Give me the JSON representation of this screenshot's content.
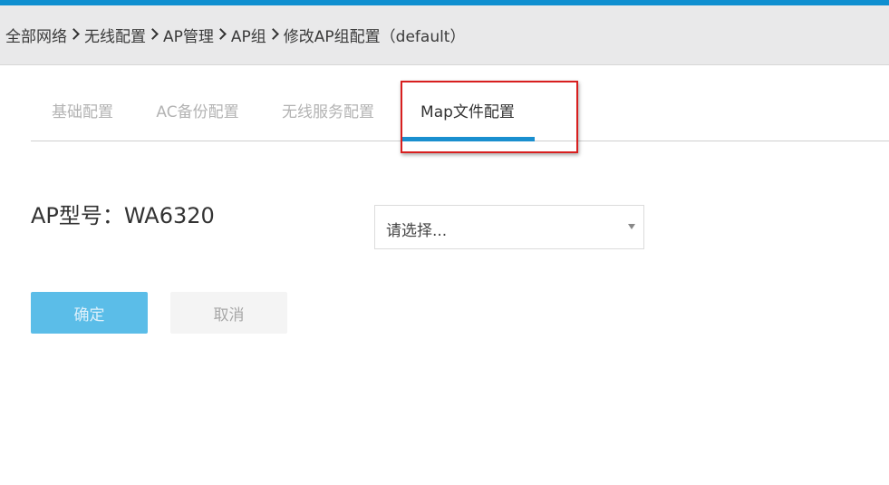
{
  "colors": {
    "top_strip": "#0f8fd0",
    "active_tab_indicator": "#1a8fcf",
    "highlight_box": "#d81f1f",
    "primary_button": "#5bbde8"
  },
  "breadcrumb": {
    "items": [
      "全部网络",
      "无线配置",
      "AP管理",
      "AP组",
      "修改AP组配置（default）"
    ]
  },
  "tabs": [
    {
      "label": "基础配置",
      "active": false
    },
    {
      "label": "AC备份配置",
      "active": false
    },
    {
      "label": "无线服务配置",
      "active": false
    },
    {
      "label": "Map文件配置",
      "active": true
    }
  ],
  "form": {
    "model_label": "AP型号：WA6320",
    "select_placeholder": "请选择..."
  },
  "buttons": {
    "ok_label": "确定",
    "cancel_label": "取消"
  },
  "icons": {
    "breadcrumb_separator": "chevron-right-icon",
    "select_arrow": "caret-down-icon"
  }
}
